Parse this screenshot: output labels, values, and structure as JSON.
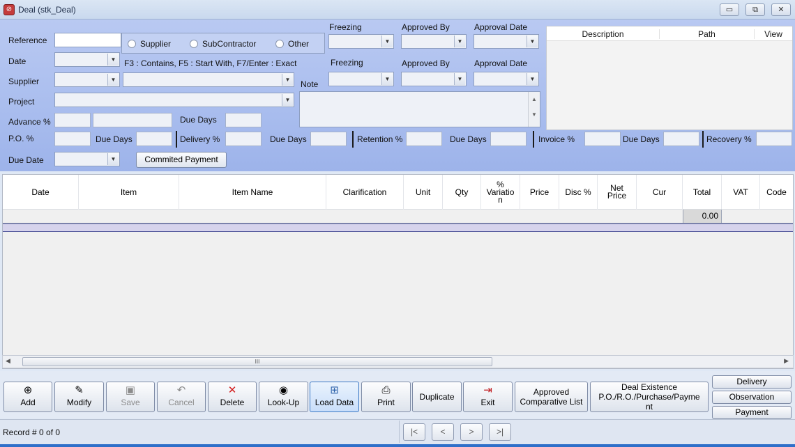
{
  "window": {
    "title": "Deal  (stk_Deal)",
    "min": "▭",
    "max": "⧉",
    "close": "✕"
  },
  "form": {
    "reference_label": "Reference",
    "date_label": "Date",
    "supplier_label": "Supplier",
    "project_label": "Project",
    "advance_label": "Advance %",
    "po_label": "P.O. %",
    "due_date_label": "Due Date",
    "radios": [
      "Supplier",
      "SubContractor",
      "Other"
    ],
    "search_hint": "F3 : Contains, F5 : Start With, F7/Enter :  Exact",
    "note_label": "Note",
    "freezing_label": "Freezing",
    "approved_by_label": "Approved By",
    "approval_date_label": "Approval Date",
    "due_days_label": "Due Days",
    "delivery_label": "Delivery %",
    "retention_label": "Retention %",
    "invoice_label": "Invoice %",
    "recovery_label": "Recovery %",
    "commited_payment": "Commited Payment"
  },
  "docs": {
    "columns": [
      "Description",
      "Path",
      "View"
    ]
  },
  "grid": {
    "columns": [
      "Date",
      "Item",
      "Item Name",
      "Clarification",
      "Unit",
      "Qty",
      "% Variatio n",
      "Price",
      "Disc %",
      "Net Price",
      "Cur",
      "Total",
      "VAT",
      "Code"
    ],
    "total_value": "0.00",
    "scroll_mark": "III"
  },
  "toolbar": {
    "add": "Add",
    "modify": "Modify",
    "save": "Save",
    "cancel": "Cancel",
    "delete": "Delete",
    "lookup": "Look-Up",
    "load": "Load Data",
    "print": "Print",
    "duplicate": "Duplicate",
    "exit": "Exit",
    "approved": "Approved Comparative List",
    "deal_existence": "Deal Existence P.O./R.O./Purchase/Payme nt",
    "delivery": "Delivery",
    "observation": "Observation",
    "payment": "Payment"
  },
  "status": {
    "record": "Record #  0 of 0",
    "nav": [
      "|<",
      "<",
      ">",
      ">|"
    ]
  },
  "icons": {
    "add": "add-icon",
    "modify": "pencil-icon",
    "save": "floppy-icon",
    "cancel": "undo-icon",
    "delete": "x-icon",
    "lookup": "binoculars-icon",
    "load": "load-data-icon",
    "print": "printer-icon",
    "exit": "exit-door-icon"
  }
}
